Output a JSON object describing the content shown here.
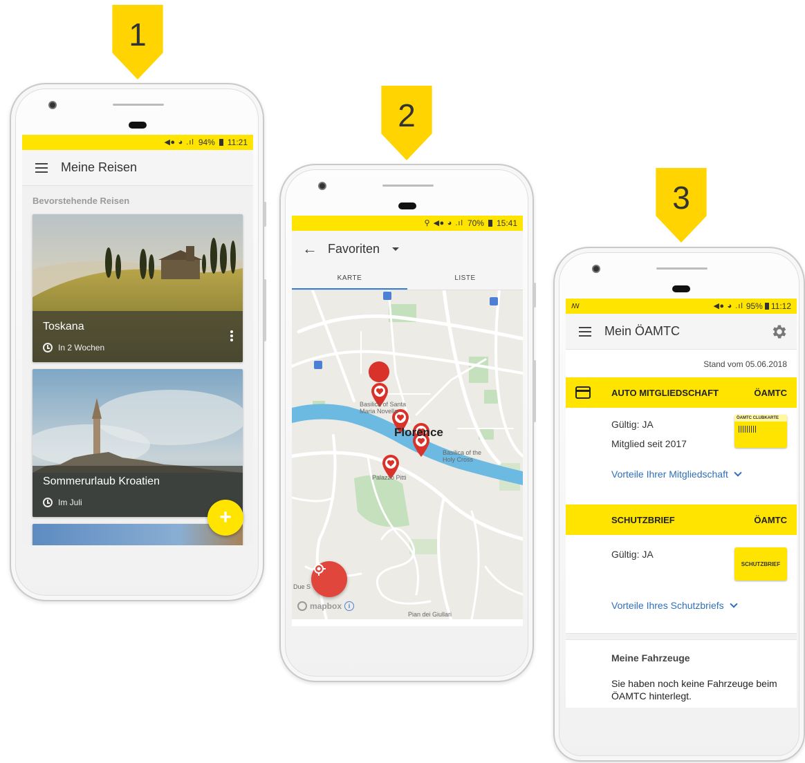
{
  "callouts": [
    "1",
    "2",
    "3"
  ],
  "screen1": {
    "status": {
      "icons": "◀⦁ ◕ .ıl",
      "battery": "94%",
      "time": "11:21"
    },
    "title": "Meine Reisen",
    "section": "Bevorstehende Reisen",
    "trips": [
      {
        "name": "Toskana",
        "when": "In 2 Wochen"
      },
      {
        "name": "Sommerurlaub Kroatien",
        "when": "Im Juli"
      }
    ],
    "fab": "+"
  },
  "screen2": {
    "status": {
      "icons": "⚲ ◀⦁ ◕ .ıl",
      "battery": "70%",
      "time": "15:41"
    },
    "title": "Favoriten",
    "tabs": [
      "KARTE",
      "LISTE"
    ],
    "map": {
      "city": "Florence",
      "labels": [
        "Basilica of Santa Maria Novella",
        "Basilica of the Holy Cross",
        "Palazzo Pitti",
        "Due S",
        "Pian dei Giullari"
      ],
      "attribution": "mapbox",
      "info": "i"
    }
  },
  "screen3": {
    "status": {
      "left": "ꟿ",
      "icons": "◀⦁ ◕ .ıl",
      "battery": "95%",
      "time": "11:12"
    },
    "title": "Mein ÖAMTC",
    "stand": "Stand vom 05.06.2018",
    "memberships": [
      {
        "name": "AUTO MITGLIEDSCHAFT",
        "brand": "ÖAMTC",
        "lines": [
          "Gültig: JA",
          "Mitglied seit 2017"
        ],
        "link": "Vorteile Ihrer Mitgliedschaft",
        "card": "ÖAMTC CLUBKARTE"
      },
      {
        "name": "SCHUTZBRIEF",
        "brand": "ÖAMTC",
        "lines": [
          "Gültig: JA"
        ],
        "link": "Vorteile Ihres Schutzbriefs",
        "card": "SCHUTZBRIEF"
      }
    ],
    "vehicles": {
      "title": "Meine Fahrzeuge",
      "text": "Sie haben noch keine Fahrzeuge beim ÖAMTC hinterlegt."
    }
  },
  "colors": {
    "yellow": "#ffe400",
    "link": "#2f6fba",
    "pin": "#d8322a",
    "fab_location": "#e0463c",
    "river": "#6cb9e2",
    "park": "#b8dcb0"
  }
}
